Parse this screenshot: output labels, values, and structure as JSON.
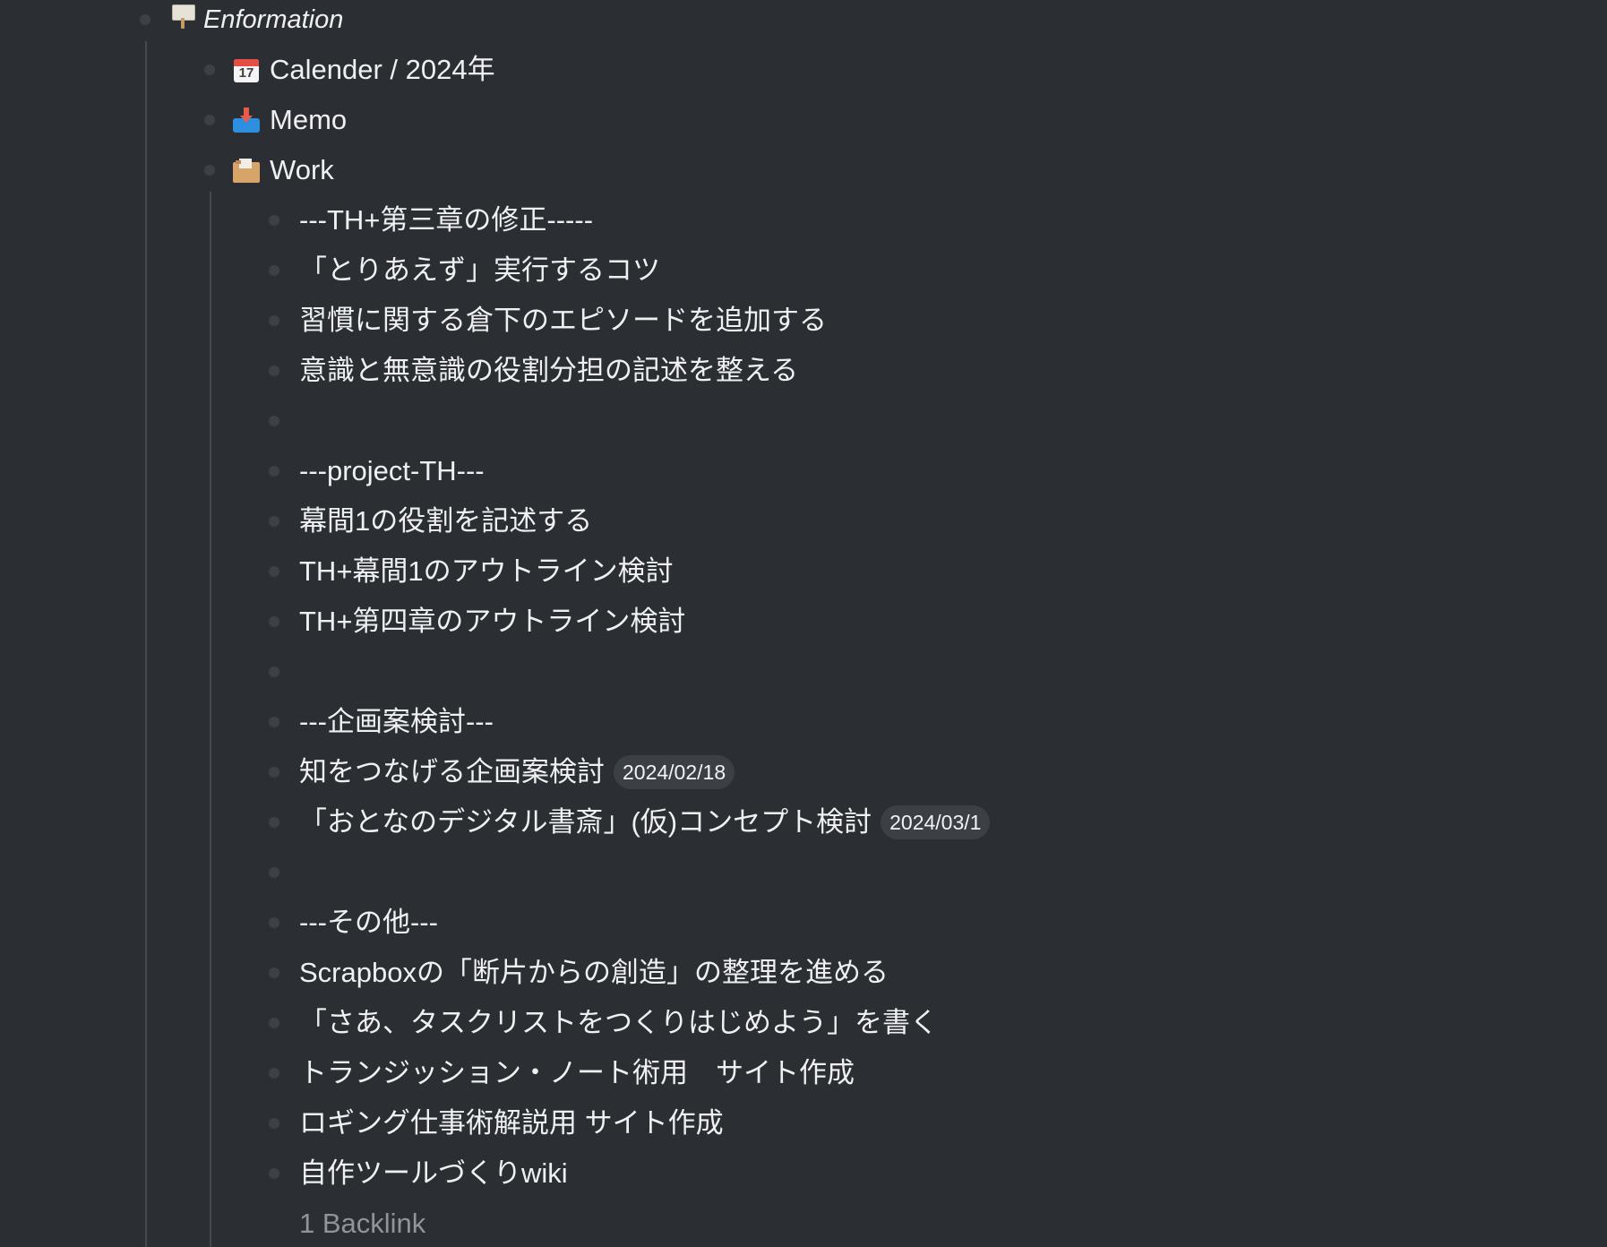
{
  "page": {
    "title": "Enformation",
    "title_icon": "signboard-icon"
  },
  "items": [
    {
      "label": "Calender / 2024年",
      "icon": "calendar-icon"
    },
    {
      "label": "Memo",
      "icon": "inbox-tray-icon"
    },
    {
      "label": "Work",
      "icon": "card-file-box-icon"
    }
  ],
  "work": {
    "rows": [
      {
        "text": "---TH+第三章の修正-----"
      },
      {
        "text": "「とりあえず」実行するコツ"
      },
      {
        "text": "習慣に関する倉下のエピソードを追加する"
      },
      {
        "text": "意識と無意識の役割分担の記述を整える"
      },
      {
        "text": ""
      },
      {
        "text": "---project-TH---"
      },
      {
        "text": "幕間1の役割を記述する"
      },
      {
        "text": "TH+幕間1のアウトライン検討"
      },
      {
        "text": "TH+第四章のアウトライン検討"
      },
      {
        "text": ""
      },
      {
        "text": "---企画案検討---"
      },
      {
        "text": "知をつなげる企画案検討",
        "date": "2024/02/18"
      },
      {
        "text": "「おとなのデジタル書斎」(仮)コンセプト検討",
        "date": "2024/03/1"
      },
      {
        "text": ""
      },
      {
        "text": "---その他---"
      },
      {
        "text": "Scrapboxの「断片からの創造」の整理を進める"
      },
      {
        "text": "「さあ、タスクリストをつくりはじめよう」を書く"
      },
      {
        "text": "トランジッション・ノート術用　サイト作成"
      },
      {
        "text": "ロギング仕事術解説用 サイト作成"
      },
      {
        "text": "自作ツールづくりwiki"
      }
    ],
    "backlink": "1 Backlink"
  },
  "colors": {
    "background": "#2b2f33",
    "text": "#eef0f2",
    "bullet": "#3c4147",
    "guide_line": "#454a50",
    "date_chip_bg": "#3b4046",
    "muted_text": "#8f959b"
  }
}
